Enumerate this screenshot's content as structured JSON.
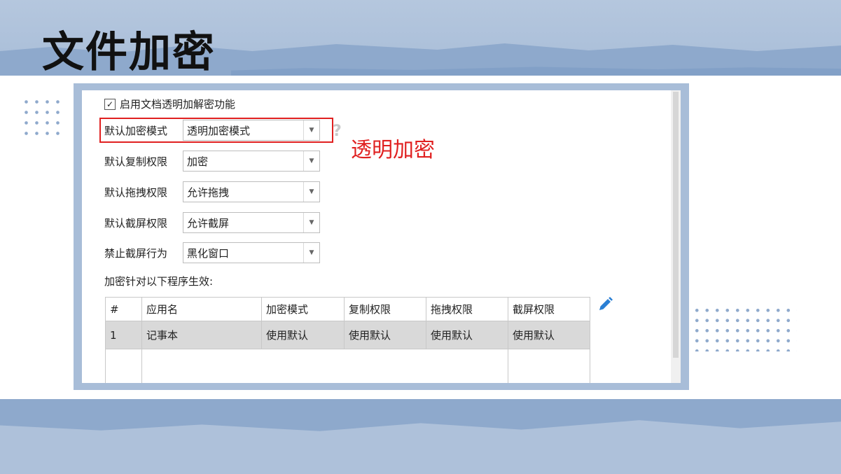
{
  "slide": {
    "title": "文件加密"
  },
  "window": {
    "enable_checkbox": {
      "label": "启用文档透明加解密功能",
      "checked": true,
      "check_glyph": "✓"
    },
    "fields": [
      {
        "label": "默认加密模式",
        "value": "透明加密模式"
      },
      {
        "label": "默认复制权限",
        "value": "加密"
      },
      {
        "label": "默认拖拽权限",
        "value": "允许拖拽"
      },
      {
        "label": "默认截屏权限",
        "value": "允许截屏"
      },
      {
        "label": "禁止截屏行为",
        "value": "黑化窗口"
      }
    ],
    "dropdown_arrow_glyph": "▼",
    "help_glyph": "?",
    "section_label": "加密针对以下程序生效:",
    "table": {
      "columns": [
        "#",
        "应用名",
        "加密模式",
        "复制权限",
        "拖拽权限",
        "截屏权限"
      ],
      "rows": [
        [
          "1",
          "记事本",
          "使用默认",
          "使用默认",
          "使用默认",
          "使用默认"
        ]
      ]
    },
    "icons": {
      "edit": "pencil-icon",
      "help": "question-icon",
      "dropdown": "chevron-down-icon"
    }
  },
  "annotation": {
    "text": "透明加密",
    "color": "#e02020"
  },
  "colors": {
    "banner": "#a8bdd8",
    "banner_brush": "#8ea9cc",
    "row_selected": "#d9d9d9",
    "edit_icon": "#2a7fd4"
  }
}
